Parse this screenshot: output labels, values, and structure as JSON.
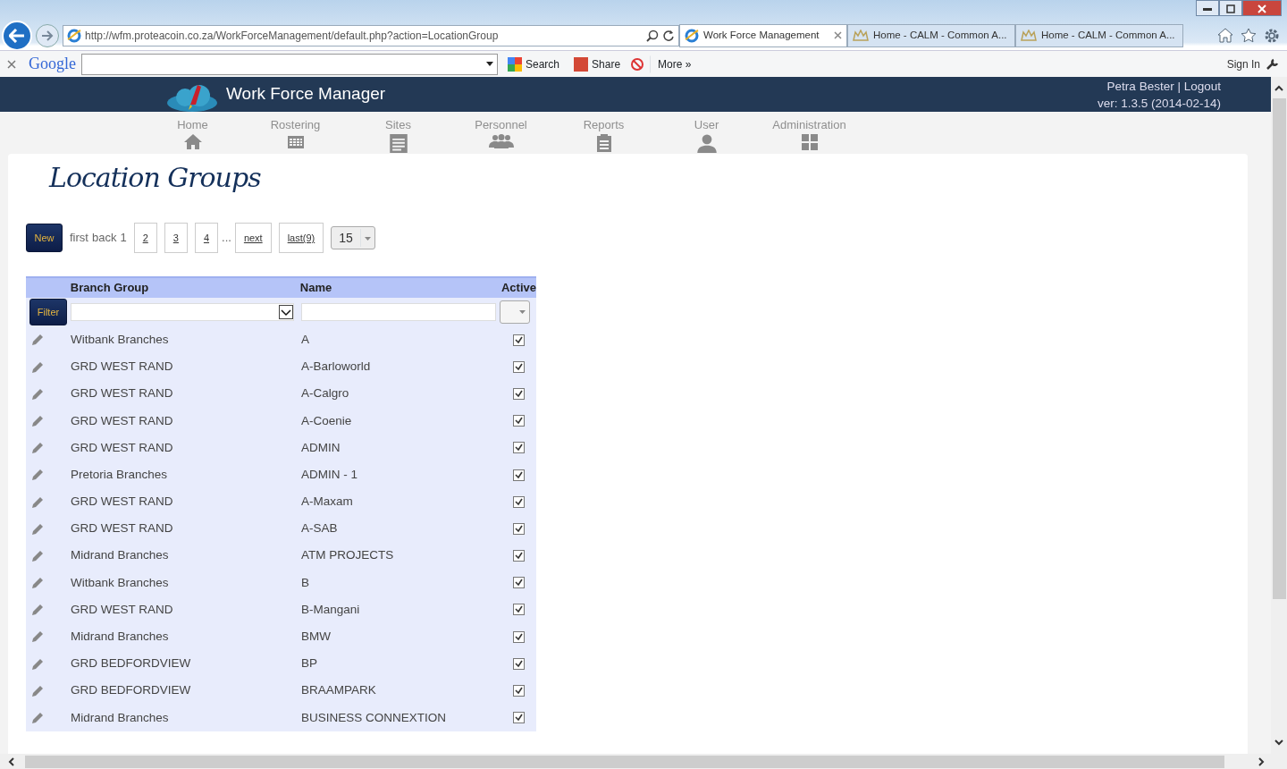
{
  "browser": {
    "address": "http://wfm.proteacoin.co.za/WorkForceManagement/default.php?action=LocationGroup",
    "tabs": [
      {
        "title": "Work Force Management",
        "selected": true
      },
      {
        "title": "Home - CALM - Common A...",
        "selected": false
      },
      {
        "title": "Home - CALM - Common A...",
        "selected": false
      }
    ],
    "toolbar": {
      "brand": "Google",
      "search": "Search",
      "share": "Share",
      "more": "More »",
      "sign_in": "Sign In"
    }
  },
  "app": {
    "title": "Work Force Manager",
    "user": "Petra Bester",
    "separator": "|",
    "logout": "Logout",
    "version": "ver: 1.3.5 (2014-02-14)"
  },
  "nav": [
    {
      "label": "Home",
      "kind": "home"
    },
    {
      "label": "Rostering",
      "kind": "calendar"
    },
    {
      "label": "Sites",
      "kind": "document"
    },
    {
      "label": "Personnel",
      "kind": "people"
    },
    {
      "label": "Reports",
      "kind": "clipboard"
    },
    {
      "label": "User",
      "kind": "person"
    },
    {
      "label": "Administration",
      "kind": "grid"
    }
  ],
  "page_title": "Location Groups",
  "pager": {
    "new": "New",
    "first": "first",
    "back": "back",
    "current": "1",
    "pages": [
      "2",
      "3",
      "4"
    ],
    "ellipsis": "...",
    "next": "next",
    "last": "last(9)",
    "page_size": "15"
  },
  "table": {
    "columns": [
      "Branch Group",
      "Name",
      "Active"
    ],
    "filter": "Filter",
    "rows": [
      {
        "branch_group": "Witbank Branches",
        "name": "A",
        "active": true
      },
      {
        "branch_group": "GRD WEST RAND",
        "name": "A-Barloworld",
        "active": true
      },
      {
        "branch_group": "GRD WEST RAND",
        "name": "A-Calgro",
        "active": true
      },
      {
        "branch_group": "GRD WEST RAND",
        "name": "A-Coenie",
        "active": true
      },
      {
        "branch_group": "GRD WEST RAND",
        "name": "ADMIN",
        "active": true
      },
      {
        "branch_group": "Pretoria Branches",
        "name": "ADMIN - 1",
        "active": true
      },
      {
        "branch_group": "GRD WEST RAND",
        "name": "A-Maxam",
        "active": true
      },
      {
        "branch_group": "GRD WEST RAND",
        "name": "A-SAB",
        "active": true
      },
      {
        "branch_group": "Midrand Branches",
        "name": "ATM PROJECTS",
        "active": true
      },
      {
        "branch_group": "Witbank Branches",
        "name": "B",
        "active": true
      },
      {
        "branch_group": "GRD WEST RAND",
        "name": "B-Mangani",
        "active": true
      },
      {
        "branch_group": "Midrand Branches",
        "name": "BMW",
        "active": true
      },
      {
        "branch_group": "GRD BEDFORDVIEW",
        "name": "BP",
        "active": true
      },
      {
        "branch_group": "GRD BEDFORDVIEW",
        "name": "BRAAMPARK",
        "active": true
      },
      {
        "branch_group": "Midrand Branches",
        "name": "BUSINESS CONNEXTION",
        "active": true
      }
    ]
  }
}
